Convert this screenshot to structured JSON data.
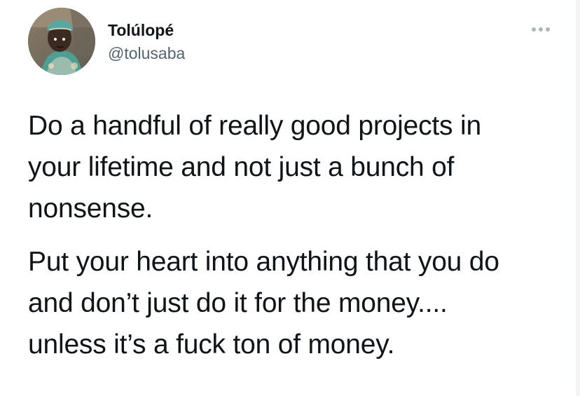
{
  "tweet": {
    "author": {
      "display_name": "Tolúlopé",
      "handle": "@tolusaba",
      "avatar_icon": "avatar-photo"
    },
    "more_icon": "more-options-icon",
    "paragraphs": [
      {
        "lines": [
          "Do a handful of really good projects in",
          "your lifetime and not just a bunch of",
          "nonsense."
        ]
      },
      {
        "lines": [
          "Put your heart into anything that you do",
          "and don’t just do it for the money....",
          "unless it’s a fuck ton of money."
        ]
      }
    ]
  },
  "colors": {
    "text": "#0f1419",
    "secondary_text": "#536471",
    "more_icon": "#aab8c2",
    "background": "#ffffff"
  }
}
